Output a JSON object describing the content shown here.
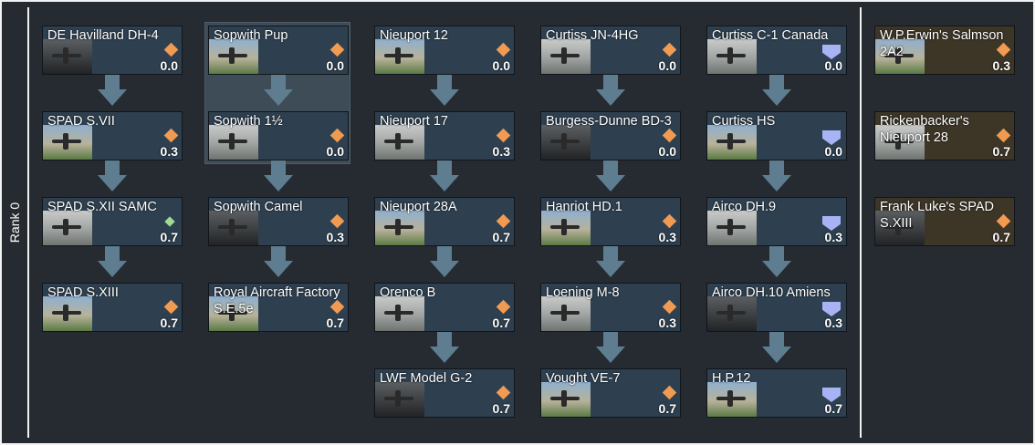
{
  "rank_label": "Rank 0",
  "columns": [
    [
      {
        "name": "DE Havilland DH-4",
        "br": "0.0",
        "icon": "orange-diamond-icon"
      },
      {
        "name": "SPAD S.VII",
        "br": "0.3",
        "icon": "orange-diamond-icon"
      },
      {
        "name": "SPAD S.XII SAMC",
        "br": "0.7",
        "icon": "green-diamond-icon"
      },
      {
        "name": "SPAD S.XIII",
        "br": "0.7",
        "icon": "orange-diamond-icon"
      }
    ],
    [
      {
        "name": "Sopwith Pup",
        "br": "0.0",
        "icon": "orange-diamond-icon"
      },
      {
        "name": "Sopwith 1½",
        "br": "0.0",
        "icon": "orange-diamond-icon"
      },
      {
        "name": "Sopwith Camel",
        "br": "0.3",
        "icon": "orange-diamond-icon"
      },
      {
        "name": "Royal Aircraft Factory S.E.5e",
        "br": "0.7",
        "icon": "orange-diamond-icon"
      }
    ],
    [
      {
        "name": "Nieuport 12",
        "br": "0.0",
        "icon": "orange-diamond-icon"
      },
      {
        "name": "Nieuport 17",
        "br": "0.3",
        "icon": "orange-diamond-icon"
      },
      {
        "name": "Nieuport 28A",
        "br": "0.7",
        "icon": "orange-diamond-icon"
      },
      {
        "name": "Orenco B",
        "br": "0.7",
        "icon": "orange-diamond-icon"
      },
      {
        "name": "LWF Model G-2",
        "br": "0.7",
        "icon": "orange-diamond-icon"
      }
    ],
    [
      {
        "name": "Curtiss JN-4HG",
        "br": "0.0",
        "icon": "orange-diamond-icon"
      },
      {
        "name": "Burgess-Dunne BD-3",
        "br": "0.0",
        "icon": "orange-diamond-icon"
      },
      {
        "name": "Hanriot HD.1",
        "br": "0.3",
        "icon": "orange-diamond-icon"
      },
      {
        "name": "Loening M-8",
        "br": "0.3",
        "icon": "orange-diamond-icon"
      },
      {
        "name": "Vought VE-7",
        "br": "0.7",
        "icon": "orange-diamond-icon"
      }
    ],
    [
      {
        "name": "Curtiss C-1 Canada",
        "br": "0.0",
        "icon": "blue-shield-icon"
      },
      {
        "name": "Curtiss HS",
        "br": "0.0",
        "icon": "blue-shield-icon"
      },
      {
        "name": "Airco DH.9",
        "br": "0.3",
        "icon": "blue-shield-icon"
      },
      {
        "name": "Airco DH.10 Amiens",
        "br": "0.3",
        "icon": "blue-shield-icon"
      },
      {
        "name": "H.P.12",
        "br": "0.7",
        "icon": "blue-shield-icon"
      }
    ]
  ],
  "premium": [
    {
      "name": "W.P.Erwin's Salmson 2A2",
      "br": "0.3",
      "icon": "orange-diamond-icon"
    },
    {
      "name": "Rickenbacker's Nieuport 28",
      "br": "0.7",
      "icon": "orange-diamond-icon"
    },
    {
      "name": "Frank Luke's SPAD S.XIII",
      "br": "0.7",
      "icon": "orange-diamond-icon"
    }
  ],
  "colors": {
    "background": "#252b31",
    "cell": "#2e4050",
    "premium_cell": "#3d3627",
    "arrow": "#5e7d90",
    "diamond": "#f09a52",
    "shield": "#a7b3f5"
  }
}
